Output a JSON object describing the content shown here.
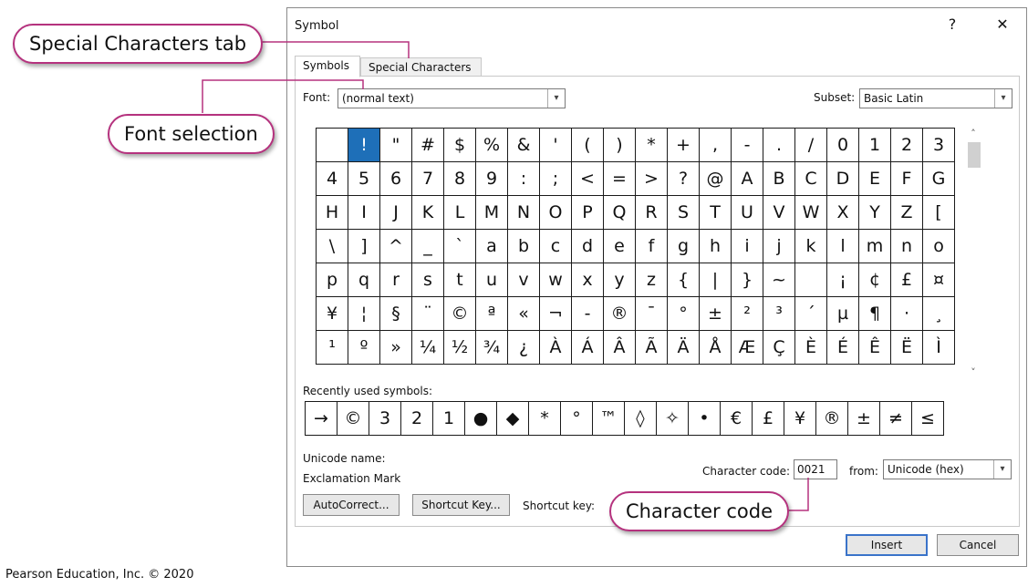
{
  "dialog": {
    "title": "Symbol",
    "help_label": "?",
    "close_label": "✕",
    "tabs": [
      {
        "label": "Symbols"
      },
      {
        "label": "Special Characters"
      }
    ],
    "font_label": "Font:",
    "font_value": "(normal text)",
    "subset_label": "Subset:",
    "subset_value": "Basic Latin",
    "grid_rows": [
      [
        " ",
        "!",
        "\"",
        "#",
        "$",
        "%",
        "&",
        "'",
        "(",
        ")",
        "*",
        "+",
        ",",
        "-",
        ".",
        "/",
        "0",
        "1",
        "2",
        "3"
      ],
      [
        "4",
        "5",
        "6",
        "7",
        "8",
        "9",
        ":",
        ";",
        "<",
        "=",
        ">",
        "?",
        "@",
        "A",
        "B",
        "C",
        "D",
        "E",
        "F",
        "G"
      ],
      [
        "H",
        "I",
        "J",
        "K",
        "L",
        "M",
        "N",
        "O",
        "P",
        "Q",
        "R",
        "S",
        "T",
        "U",
        "V",
        "W",
        "X",
        "Y",
        "Z",
        "["
      ],
      [
        "\\",
        "]",
        "^",
        "_",
        "`",
        "a",
        "b",
        "c",
        "d",
        "e",
        "f",
        "g",
        "h",
        "i",
        "j",
        "k",
        "l",
        "m",
        "n",
        "o"
      ],
      [
        "p",
        "q",
        "r",
        "s",
        "t",
        "u",
        "v",
        "w",
        "x",
        "y",
        "z",
        "{",
        "|",
        "}",
        "~",
        " ",
        "¡",
        "¢",
        "£",
        "¤"
      ],
      [
        "¥",
        "¦",
        "§",
        "¨",
        "©",
        "ª",
        "«",
        "¬",
        "-",
        "®",
        "¯",
        "°",
        "±",
        "²",
        "³",
        "´",
        "µ",
        "¶",
        "·",
        "¸"
      ],
      [
        "¹",
        "º",
        "»",
        "¼",
        "½",
        "¾",
        "¿",
        "À",
        "Á",
        "Â",
        "Ã",
        "Ä",
        "Å",
        "Æ",
        "Ç",
        "È",
        "É",
        "Ê",
        "Ë",
        "Ì"
      ]
    ],
    "selected_symbol": "!",
    "recent_label": "Recently used symbols:",
    "recent_symbols": [
      "→",
      "©",
      "3",
      "2",
      "1",
      "●",
      "◆",
      "*",
      "°",
      "™",
      "◊",
      "✧",
      "•",
      "€",
      "£",
      "¥",
      "®",
      "±",
      "≠",
      "≤"
    ],
    "unicode_name_label": "Unicode name:",
    "unicode_name_value": "Exclamation Mark",
    "char_code_label": "Character code:",
    "char_code_value": "0021",
    "from_label": "from:",
    "from_value": "Unicode (hex)",
    "autocorrect_label": "AutoCorrect...",
    "shortcut_key_button_label": "Shortcut Key...",
    "shortcut_key_label": "Shortcut key:",
    "insert_label": "Insert",
    "cancel_label": "Cancel"
  },
  "callouts": {
    "special_chars": "Special Characters tab",
    "font_selection": "Font selection",
    "character_code": "Character code"
  },
  "footer": "Pearson Education, Inc. © 2020",
  "colors": {
    "accent": "#b5327e",
    "selection": "#1e6fb8"
  }
}
